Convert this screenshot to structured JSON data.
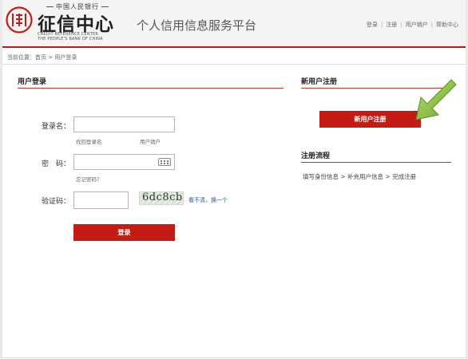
{
  "header": {
    "logo_top": "中国人民银行",
    "logo_main": "征信中心",
    "logo_en_line1": "CREDIT REFERENCE CENTER",
    "logo_en_line2": "THE PEOPLE'S BANK OF CHINA",
    "platform_title": "个人信用信息服务平台",
    "nav": {
      "login": "登录",
      "register": "注册",
      "logout": "用户销户",
      "help": "帮助中心"
    }
  },
  "breadcrumb": "当前位置：首页 > 用户登录",
  "login": {
    "title": "用户登录",
    "username_label": "登录名：",
    "username_value": "",
    "recover_username": "找回登录名",
    "cancel_account": "用户销户",
    "password_label": "密　码：",
    "password_value": "",
    "forgot_password": "忘记密码？",
    "captcha_label": "验证码：",
    "captcha_value": "",
    "captcha_image_text": "6dc8cb",
    "refresh_captcha": "看不清，换一个",
    "submit_label": "登录"
  },
  "register": {
    "title": "新用户注册",
    "button_label": "新用户注册"
  },
  "process": {
    "title": "注册流程",
    "steps": "填写身份信息 > 补充用户信息 > 完成注册"
  },
  "colors": {
    "brand_red": "#c41c14",
    "header_rule": "#b81c1c",
    "link_blue": "#1a57b8",
    "arrow_green": "#8cc63f"
  }
}
